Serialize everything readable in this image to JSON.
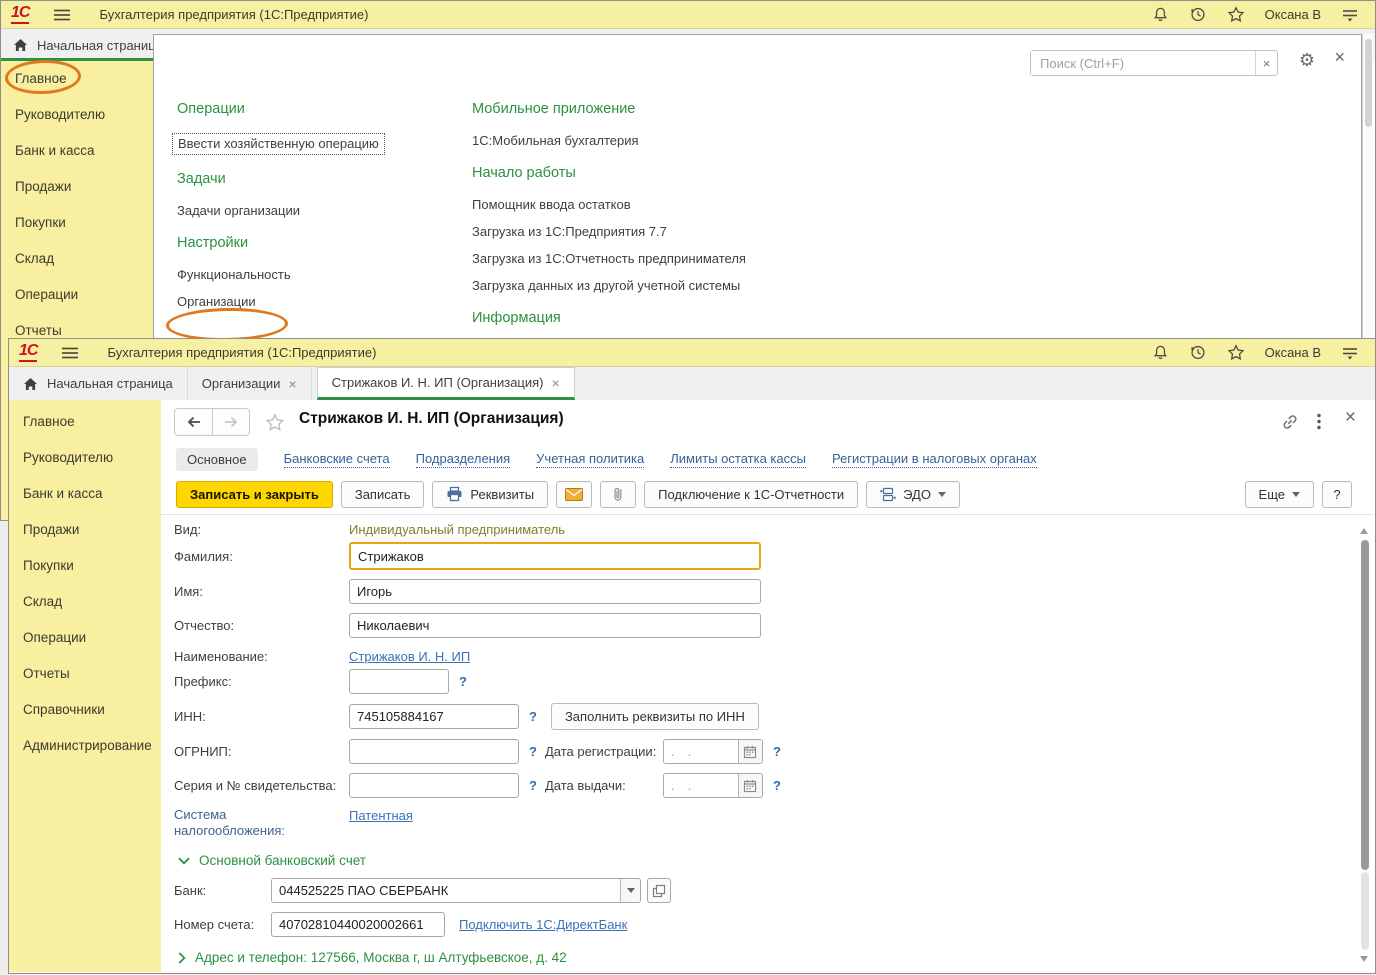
{
  "chrome": {
    "logo": "1С",
    "app_title": "Бухгалтерия предприятия  (1С:Предприятие)",
    "user_name": "Оксана В"
  },
  "top_window": {
    "tab_home": "Начальная страница",
    "search_placeholder": "Поиск (Ctrl+F)",
    "sidebar_items": [
      "Главное",
      "Руководителю",
      "Банк и касса",
      "Продажи",
      "Покупки",
      "Склад",
      "Операции",
      "Отчеты"
    ],
    "columns": [
      {
        "sections": [
          {
            "header": "Операции",
            "items": [
              "Ввести хозяйственную операцию"
            ]
          },
          {
            "header": "Задачи",
            "items": [
              "Задачи организации"
            ]
          },
          {
            "header": "Настройки",
            "items": [
              "Функциональность",
              "Организации"
            ]
          }
        ]
      },
      {
        "sections": [
          {
            "header": "Мобильное приложение",
            "items": [
              "1С:Мобильная бухгалтерия"
            ]
          },
          {
            "header": "Начало работы",
            "items": [
              "Помощник ввода остатков",
              "Загрузка из 1С:Предприятия 7.7",
              "Загрузка из 1С:Отчетность предпринимателя",
              "Загрузка данных из другой учетной системы"
            ]
          },
          {
            "header": "Информация",
            "items": []
          }
        ]
      }
    ]
  },
  "bottom_window": {
    "tabs": [
      "Начальная страница",
      "Организации",
      "Стрижаков И. Н. ИП (Организация)"
    ],
    "sidebar_items": [
      "Главное",
      "Руководителю",
      "Банк и касса",
      "Продажи",
      "Покупки",
      "Склад",
      "Операции",
      "Отчеты",
      "Справочники",
      "Администрирование"
    ],
    "form": {
      "title": "Стрижаков И. Н. ИП (Организация)",
      "nav": {
        "main": "Основное",
        "accounts": "Банковские счета",
        "departments": "Подразделения",
        "policy": "Учетная политика",
        "limits": "Лимиты остатка кассы",
        "registrations": "Регистрации в налоговых органах"
      },
      "toolbar": {
        "save_close": "Записать и закрыть",
        "save": "Записать",
        "requisites": "Реквизиты",
        "connect": "Подключение к 1С-Отчетности",
        "edo": "ЭДО",
        "more": "Еще",
        "help": "?"
      },
      "hint": "?",
      "fields": {
        "vid_label": "Вид:",
        "vid_value": "Индивидуальный предприниматель",
        "lastname_label": "Фамилия:",
        "lastname_value": "Стрижаков",
        "firstname_label": "Имя:",
        "firstname_value": "Игорь",
        "middlename_label": "Отчество:",
        "middlename_value": "Николаевич",
        "fullname_label": "Наименование:",
        "fullname_value": "Стрижаков И. Н. ИП",
        "prefix_label": "Префикс:",
        "inn_label": "ИНН:",
        "inn_value": "745105884167",
        "fill_by_inn": "Заполнить реквизиты по ИНН",
        "ogrnip_label": "ОГРНИП:",
        "reg_date_label": "Дата регистрации:",
        "issue_date_label": "Дата выдачи:",
        "date_placeholder": ".  .",
        "cert_label": "Серия и № свидетельства:",
        "tax_label_1": "Система",
        "tax_label_2": "налогообложения:",
        "tax_value": "Патентная"
      },
      "bank": {
        "header": "Основной банковский счет",
        "bank_label": "Банк:",
        "bank_value": "044525225 ПАО СБЕРБАНК",
        "account_label": "Номер счета:",
        "account_value": "40702810440020002661",
        "directbank": "Подключить 1С:ДиректБанк"
      },
      "address": "Адрес и телефон: 127566, Москва г, ш Алтуфьевское, д. 42"
    }
  }
}
